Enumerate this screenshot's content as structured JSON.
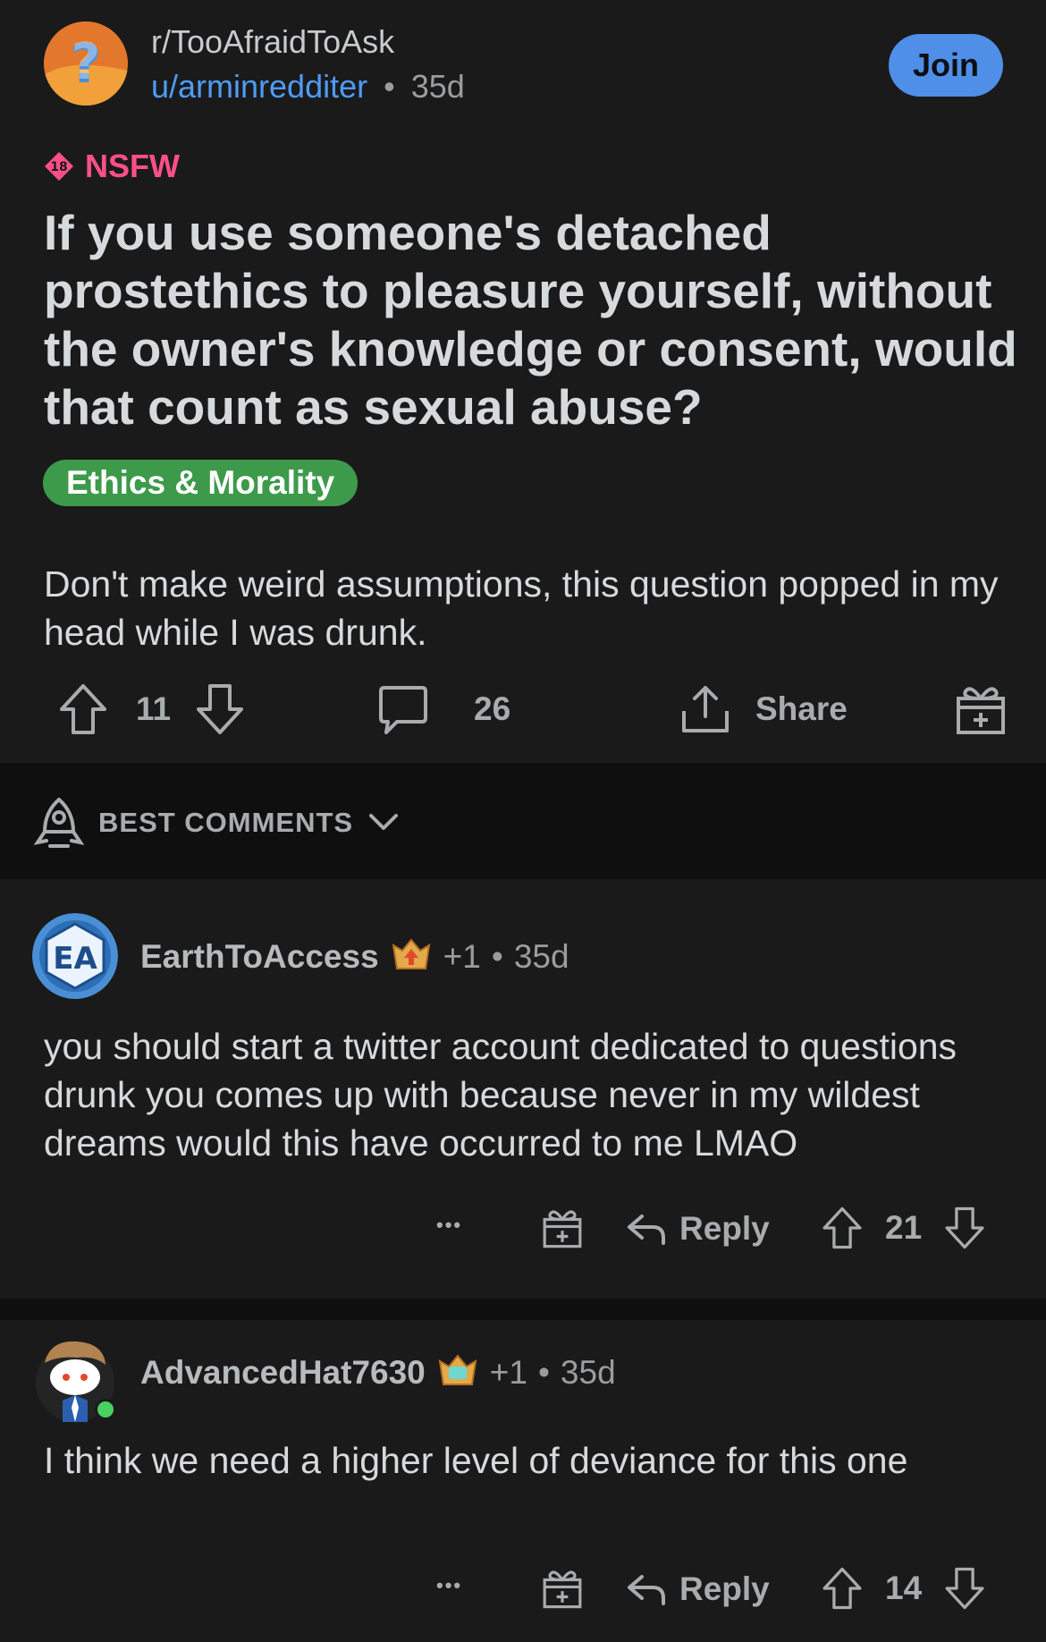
{
  "post": {
    "subreddit": "r/TooAfraidToAsk",
    "author": "u/arminredditer",
    "separator": "•",
    "age": "35d",
    "join_label": "Join",
    "nsfw_label": "NSFW",
    "nsfw_badge": "18",
    "title": "If you use someone's detached prostethics to pleasure yourself, without the owner's knowledge or consent, would that count as sexual abuse?",
    "flair": "Ethics & Morality",
    "body": "Don't make weird assumptions, this question popped in my head while I was drunk.",
    "votes": "11",
    "comments_count": "26",
    "share_label": "Share"
  },
  "sort": {
    "label": "BEST COMMENTS"
  },
  "comments": [
    {
      "author": "EarthToAccess",
      "karma": "+1",
      "separator": "•",
      "age": "35d",
      "text": "you should start a twitter account dedicated to questions drunk you comes up with because never in my wildest dreams would this have occurred to me LMAO",
      "more": "•••",
      "reply_label": "Reply",
      "votes": "21"
    },
    {
      "author": "AdvancedHat7630",
      "karma": "+1",
      "separator": "•",
      "age": "35d",
      "text": "I think we need a higher level of deviance for this one",
      "more": "•••",
      "reply_label": "Reply",
      "votes": "14"
    }
  ],
  "colors": {
    "background": "#1a1a1b",
    "accent_blue": "#4f8fe8",
    "nsfw_pink": "#ff4f8a",
    "flair_green": "#3d9a4a",
    "online_green": "#46d160"
  },
  "icons": [
    "subreddit-avatar",
    "nsfw-18-icon",
    "upvote-icon",
    "downvote-icon",
    "comment-icon",
    "share-icon",
    "award-icon",
    "sort-rocket-icon",
    "chevron-down-icon",
    "more-icon",
    "reply-icon",
    "achievement-badge-icon"
  ]
}
